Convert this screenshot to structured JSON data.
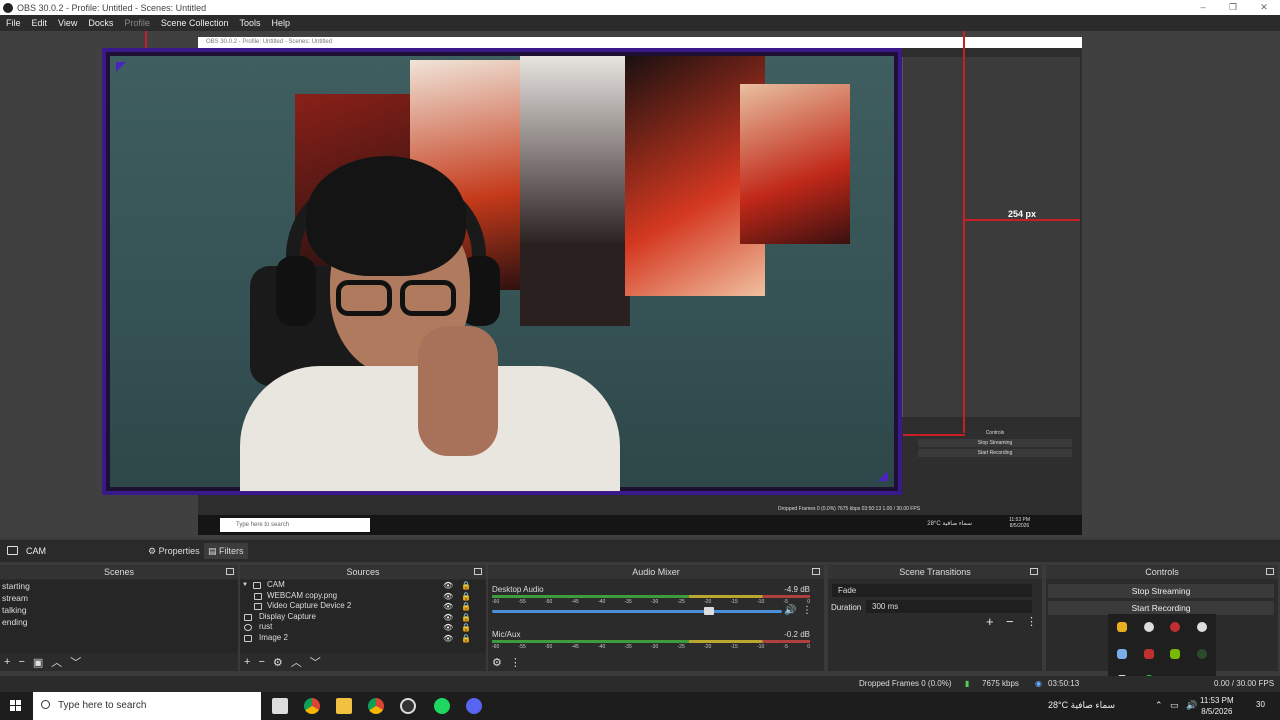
{
  "window": {
    "title": "OBS 30.0.2 - Profile: Untitled - Scenes: Untitled",
    "minimize": "–",
    "restore": "❐",
    "close": "✕"
  },
  "menu": [
    "File",
    "Edit",
    "View",
    "Docks",
    "Profile",
    "Scene Collection",
    "Tools",
    "Help"
  ],
  "preview": {
    "inner_title": "OBS 30.0.2 - Profile: Untitled - Scenes: Untitled",
    "px_label": "254 px",
    "inner_controls": {
      "header": "Controls",
      "stop_streaming": "Stop Streaming",
      "start_recording": "Start Recording"
    },
    "inner_status": "Dropped Frames 0 (0.0%)   7675 kbps   03:50:13          1.00 / 30.00 FPS",
    "inner_taskbar": {
      "search": "Type here to search",
      "weather": "28°C  سماء صافية",
      "time": "11:53 PM",
      "date": "8/5/2026"
    }
  },
  "scene_bar": {
    "current_scene": "CAM",
    "properties": "Properties",
    "filters": "Filters"
  },
  "docks": {
    "scenes": {
      "title": "Scenes",
      "items": [
        "starting",
        "stream",
        "talking",
        "ending"
      ]
    },
    "sources": {
      "title": "Sources",
      "items": [
        {
          "name": "CAM",
          "indent": 0,
          "group": true
        },
        {
          "name": "WEBCAM copy.png",
          "indent": 1
        },
        {
          "name": "Video Capture Device 2",
          "indent": 1
        },
        {
          "name": "Display Capture",
          "indent": 0
        },
        {
          "name": "rust",
          "indent": 0
        },
        {
          "name": "Image 2",
          "indent": 0
        }
      ]
    },
    "audio_mixer": {
      "title": "Audio Mixer",
      "channels": [
        {
          "name": "Desktop Audio",
          "db": "-4.9 dB"
        },
        {
          "name": "Mic/Aux",
          "db": "-0.2 dB"
        }
      ],
      "ticks": [
        "-60",
        "-55",
        "-50",
        "-45",
        "-40",
        "-35",
        "-30",
        "-25",
        "-20",
        "-15",
        "-10",
        "-5",
        "0"
      ]
    },
    "scene_transitions": {
      "title": "Scene Transitions",
      "transition": "Fade",
      "duration_label": "Duration",
      "duration_value": "300 ms"
    },
    "controls": {
      "title": "Controls",
      "stop_streaming": "Stop Streaming",
      "start_recording": "Start Recording"
    }
  },
  "status": {
    "dropped": "Dropped Frames 0 (0.0%)",
    "kbps": "7675 kbps",
    "time": "03:50:13",
    "fps": "0.00 / 30.00 FPS"
  },
  "taskbar": {
    "search": "Type here to search",
    "weather": "28°C  سماء صافية",
    "time": "11:53 PM",
    "date": "8/5/2026",
    "notifications": "30"
  }
}
